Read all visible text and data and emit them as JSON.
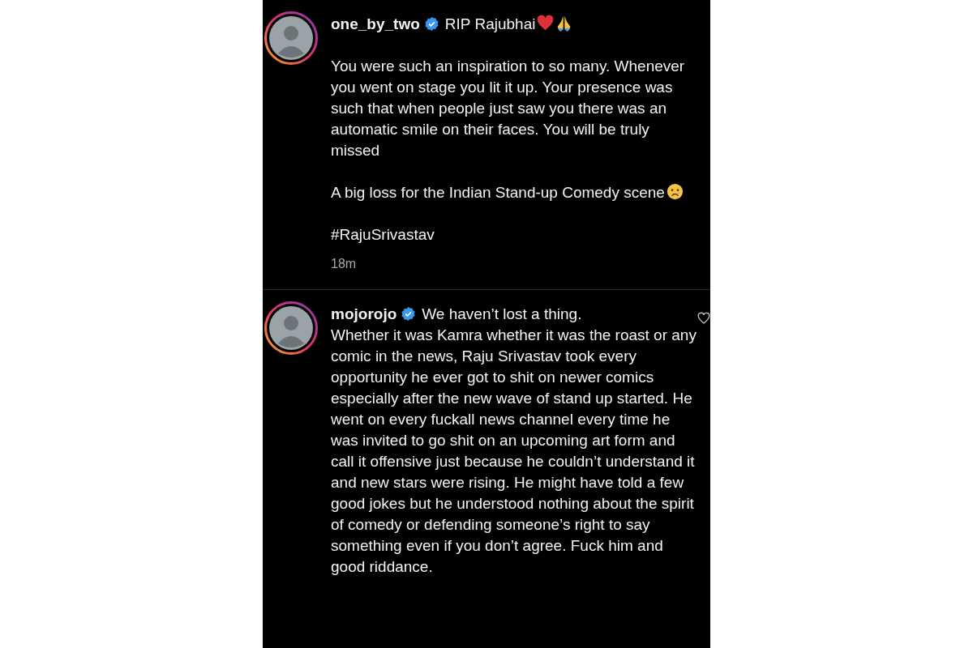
{
  "comments": [
    {
      "username": "one_by_two",
      "verified": true,
      "like_icon": false,
      "header_text": "RIP Rajubhai",
      "header_icons": [
        {
          "kind": "heart"
        },
        {
          "kind": "folded-hands"
        }
      ],
      "header_separated": true,
      "time": "18m",
      "paragraphs": [
        {
          "text": "You were such an inspiration to so many. Whenever you went on stage you lit it up. Your presence was such that when people just saw you there was an automatic smile on their faces. You will be truly missed"
        },
        {
          "text": "A big loss for the Indian Stand-up Comedy scene",
          "icons": [
            {
              "kind": "sad-face"
            }
          ]
        },
        {
          "text": "#RajuSrivastav"
        }
      ]
    },
    {
      "username": "mojorojo",
      "verified": true,
      "like_icon": true,
      "header_text": "We haven’t lost a thing.",
      "header_separated": false,
      "paragraphs": [
        {
          "text": "Whether it was Kamra whether it was the roast or any comic in the news, Raju Srivastav took every opportunity he ever got to shit on newer comics especially after the new wave of stand up started. He went on every fuckall news channel every time he was invited to go shit on an upcoming art form and call it offensive just because he couldn’t understand it and new stars were rising. He might have told a few good jokes but he understood nothing about the spirit of comedy or defending someone’s right to say something even if you don’t agree. Fuck him and good riddance."
        }
      ]
    }
  ]
}
